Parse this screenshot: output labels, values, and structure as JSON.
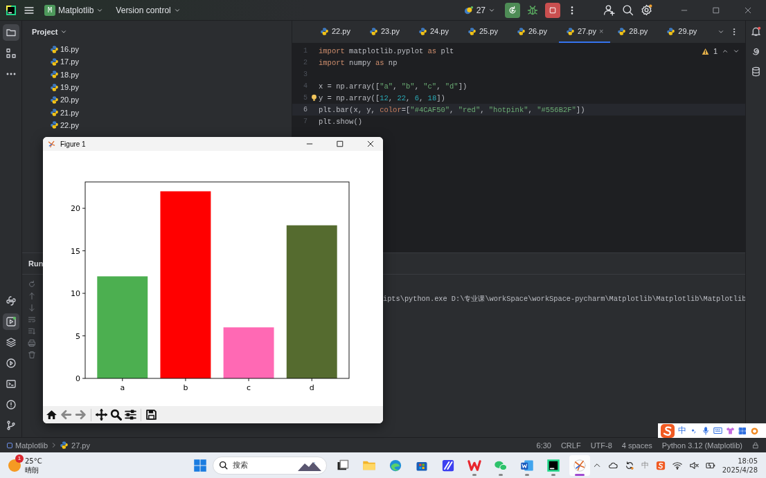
{
  "toolbar": {
    "project_badge": "M",
    "project": "Matplotlib",
    "vcs": "Version control",
    "run_config": "27"
  },
  "left_tools_top": [
    {
      "kind": "folder",
      "selected": true
    },
    {
      "kind": "structure",
      "selected": false
    },
    {
      "kind": "more",
      "selected": false
    }
  ],
  "left_tools_bottom": [
    {
      "kind": "python",
      "selected": false
    },
    {
      "kind": "run",
      "selected": true
    },
    {
      "kind": "layers",
      "selected": false
    },
    {
      "kind": "services",
      "selected": false
    },
    {
      "kind": "terminal",
      "selected": false
    },
    {
      "kind": "problems",
      "selected": false
    },
    {
      "kind": "git",
      "selected": false
    }
  ],
  "project_panel": {
    "title": "Project",
    "files": [
      "16.py",
      "17.py",
      "18.py",
      "19.py",
      "20.py",
      "21.py",
      "22.py"
    ]
  },
  "tabs": [
    {
      "label": "22.py",
      "selected": false
    },
    {
      "label": "23.py",
      "selected": false
    },
    {
      "label": "24.py",
      "selected": false
    },
    {
      "label": "25.py",
      "selected": false
    },
    {
      "label": "26.py",
      "selected": false
    },
    {
      "label": "27.py",
      "selected": true,
      "close": "×"
    },
    {
      "label": "28.py",
      "selected": false
    },
    {
      "label": "29.py",
      "selected": false
    }
  ],
  "editor": {
    "warnings": "1",
    "lines": [
      {
        "number": "1",
        "current": false,
        "hint": false,
        "tokens": [
          {
            "kind": "keyword",
            "text": "import"
          },
          {
            "kind": "plain",
            "text": " matplotlib.pyplot "
          },
          {
            "kind": "keyword",
            "text": "as"
          },
          {
            "kind": "plain",
            "text": " plt"
          }
        ]
      },
      {
        "number": "2",
        "current": false,
        "hint": false,
        "tokens": [
          {
            "kind": "keyword",
            "text": "import"
          },
          {
            "kind": "plain",
            "text": " numpy "
          },
          {
            "kind": "keyword",
            "text": "as"
          },
          {
            "kind": "plain",
            "text": " np"
          }
        ]
      },
      {
        "number": "3",
        "current": false,
        "hint": false
      },
      {
        "number": "4",
        "current": false,
        "hint": false,
        "tokens": [
          {
            "kind": "plain",
            "text": "x = np.array(["
          },
          {
            "kind": "string",
            "text": "\"a\""
          },
          {
            "kind": "plain",
            "text": ", "
          },
          {
            "kind": "string",
            "text": "\"b\""
          },
          {
            "kind": "plain",
            "text": ", "
          },
          {
            "kind": "string",
            "text": "\"c\""
          },
          {
            "kind": "plain",
            "text": ", "
          },
          {
            "kind": "string",
            "text": "\"d\""
          },
          {
            "kind": "plain",
            "text": "])"
          }
        ]
      },
      {
        "number": "5",
        "current": false,
        "hint": true,
        "tokens": [
          {
            "kind": "plain",
            "text": "y = np.array(["
          },
          {
            "kind": "number",
            "text": "12"
          },
          {
            "kind": "plain",
            "text": ", "
          },
          {
            "kind": "number",
            "text": "22"
          },
          {
            "kind": "plain",
            "text": ", "
          },
          {
            "kind": "number",
            "text": "6"
          },
          {
            "kind": "plain",
            "text": ", "
          },
          {
            "kind": "number",
            "text": "18"
          },
          {
            "kind": "plain",
            "text": "])"
          }
        ]
      },
      {
        "number": "6",
        "current": true,
        "hint": false,
        "tokens": [
          {
            "kind": "plain",
            "text": "plt.bar(x, y, "
          },
          {
            "kind": "param",
            "text": "color"
          },
          {
            "kind": "plain",
            "text": "=["
          },
          {
            "kind": "string",
            "text": "\"#4CAF50\""
          },
          {
            "kind": "plain",
            "text": ", "
          },
          {
            "kind": "string",
            "text": "\"red\""
          },
          {
            "kind": "plain",
            "text": ", "
          },
          {
            "kind": "string",
            "text": "\"hotpink\""
          },
          {
            "kind": "plain",
            "text": ", "
          },
          {
            "kind": "string",
            "text": "\"#556B2F\""
          },
          {
            "kind": "plain",
            "text": "])"
          }
        ]
      },
      {
        "number": "7",
        "current": false,
        "hint": false,
        "tokens": [
          {
            "kind": "plain",
            "text": "plt.show()"
          }
        ]
      }
    ]
  },
  "run_panel": {
    "title": "Run",
    "console": "ipts\\python.exe D:\\专业课\\workSpace\\workSpace-pycharm\\Matplotlib\\Matplotlib\\Matplotlib"
  },
  "figure": {
    "title": "Figure 1",
    "chart_data": {
      "type": "bar",
      "categories": [
        "a",
        "b",
        "c",
        "d"
      ],
      "series": [
        {
          "color": "#4caf50",
          "values": [
            12,
            null,
            null,
            null
          ]
        },
        {
          "color": "#ff0000",
          "values": [
            null,
            22,
            null,
            null
          ]
        },
        {
          "color": "#ff69b4",
          "values": [
            null,
            null,
            6,
            null
          ]
        },
        {
          "color": "#556b2f",
          "values": [
            null,
            null,
            null,
            18
          ]
        }
      ],
      "stacked": true,
      "ylim": [
        0,
        23.1
      ],
      "yticks": [
        0,
        5,
        10,
        15,
        20
      ]
    },
    "toolbar": [
      {
        "kind": "home",
        "disabled": false
      },
      {
        "kind": "back",
        "disabled": true
      },
      {
        "kind": "forward",
        "disabled": true
      },
      {
        "kind": "pan",
        "disabled": false
      },
      {
        "kind": "zoom",
        "disabled": false
      },
      {
        "kind": "configure",
        "disabled": false
      },
      {
        "kind": "save",
        "disabled": false
      }
    ]
  },
  "status_bar": {
    "breadcrumbs": [
      "Matplotlib",
      "27.py"
    ],
    "position": "6:30",
    "line_ending": "CRLF",
    "encoding": "UTF-8",
    "indent": "4 spaces",
    "interpreter": "Python 3.12 (Matplotlib)"
  },
  "ime_bar": {
    "mode": "中"
  },
  "taskbar": {
    "weather_badge": "1",
    "temperature": "25°C",
    "condition": "晴朗",
    "search_placeholder": "搜索",
    "apps": [
      {
        "kind": "task-view",
        "running": false,
        "selected": false
      },
      {
        "kind": "explorer",
        "running": false,
        "selected": false
      },
      {
        "kind": "edge",
        "running": false,
        "selected": false
      },
      {
        "kind": "store",
        "running": false,
        "selected": false
      },
      {
        "kind": "blue-app",
        "running": false,
        "selected": false
      },
      {
        "kind": "wps",
        "running": true,
        "selected": false
      },
      {
        "kind": "chat",
        "running": true,
        "selected": false
      },
      {
        "kind": "word",
        "running": true,
        "selected": false
      },
      {
        "kind": "pycharm",
        "running": true,
        "selected": false
      },
      {
        "kind": "figure",
        "running": true,
        "selected": true
      }
    ],
    "tray_ime": "中",
    "time": "18:05",
    "date": "2025/4/28"
  }
}
